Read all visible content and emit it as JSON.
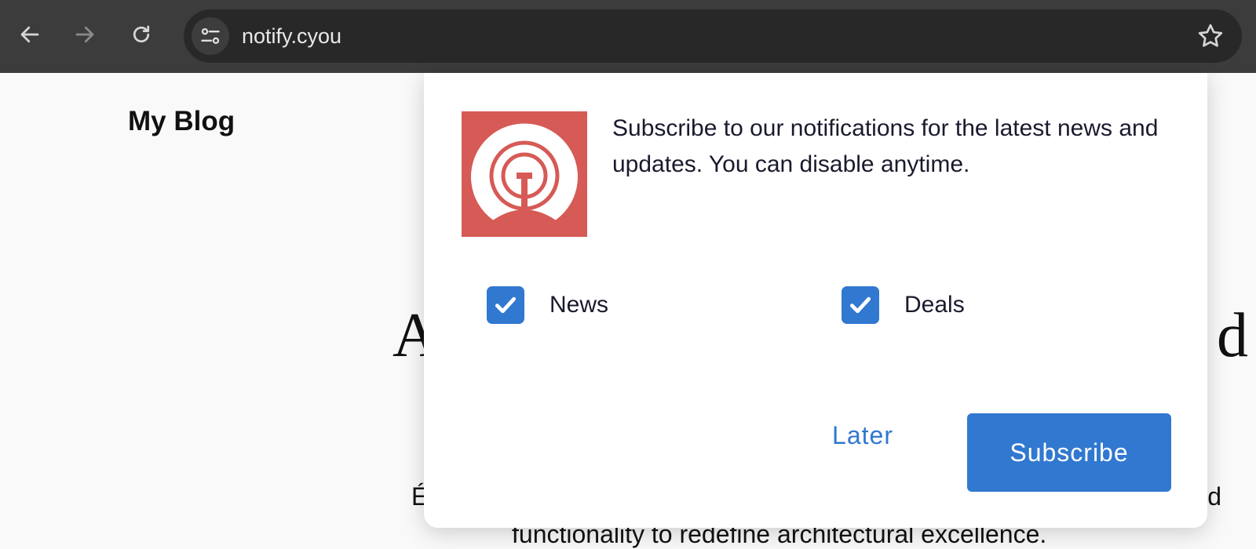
{
  "browser": {
    "url": "notify.cyou",
    "icons": {
      "back": "arrow-left-icon",
      "forward": "arrow-right-icon",
      "reload": "reload-icon",
      "site_info": "tune-icon",
      "bookmark": "star-icon"
    }
  },
  "page": {
    "site_title": "My Blog",
    "headline_left": "A",
    "headline_right": "d",
    "intro_line1_left": "É",
    "intro_line1_right": "d",
    "intro_line2": "functionality to redefine architectural excellence."
  },
  "modal": {
    "message": "Subscribe to our notifications for the latest news and updates. You can disable anytime.",
    "options": [
      {
        "label": "News",
        "checked": true
      },
      {
        "label": "Deals",
        "checked": true
      }
    ],
    "later_label": "Later",
    "subscribe_label": "Subscribe",
    "logo_icon": "onesignal-logo-icon"
  },
  "colors": {
    "toolbar": "#3c3c3c",
    "address_bar": "#282828",
    "accent": "#3178d0",
    "logo_bg": "#d65a55"
  }
}
